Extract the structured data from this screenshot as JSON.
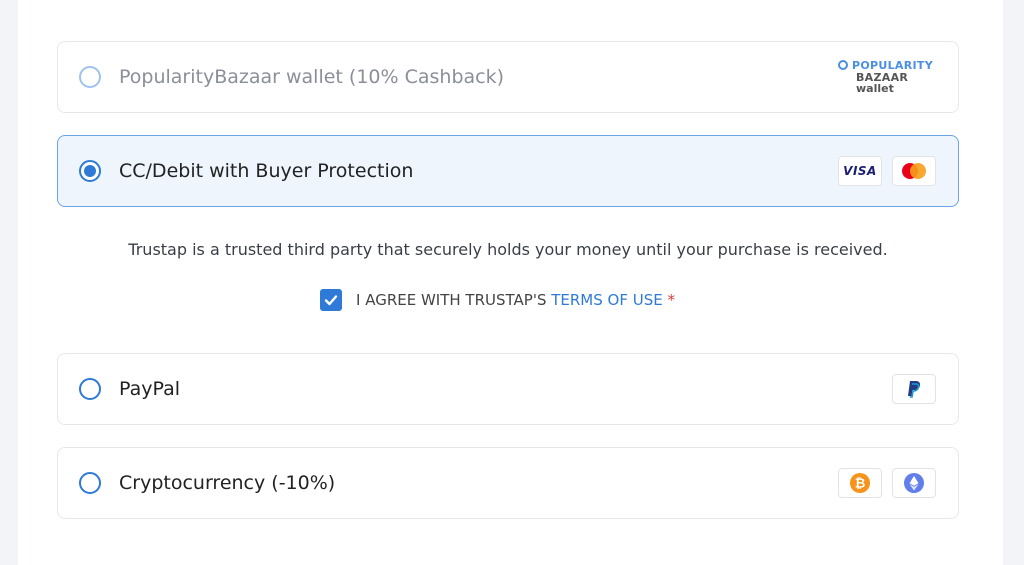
{
  "options": [
    {
      "label": "PopularityBazaar wallet (10% Cashback)",
      "selected": false,
      "logo_text": [
        "POPULARITY",
        "BAZAAR",
        "wallet"
      ]
    },
    {
      "label": "CC/Debit with Buyer Protection",
      "selected": true,
      "badges": [
        "visa-icon",
        "mastercard-icon"
      ],
      "visa_text": "VISA"
    },
    {
      "label": "PayPal",
      "selected": false,
      "badges": [
        "paypal-icon"
      ]
    },
    {
      "label": "Cryptocurrency (-10%)",
      "selected": false,
      "badges": [
        "bitcoin-icon",
        "ethereum-icon"
      ]
    }
  ],
  "trustap": {
    "info": "Trustap is a trusted third party that securely holds your money until your purchase is received.",
    "agree_prefix": "I AGREE WITH TRUSTAP'S ",
    "terms_link": "TERMS OF USE",
    "required_mark": " *",
    "checked": true
  },
  "colors": {
    "accent": "#2f7ad6",
    "selected_bg": "#eef5fd",
    "required": "#d23b3b",
    "bitcoin": "#f7931a",
    "ethereum": "#627eea",
    "mastercard_red": "#eb001b",
    "mastercard_yellow": "#f79e1b"
  }
}
